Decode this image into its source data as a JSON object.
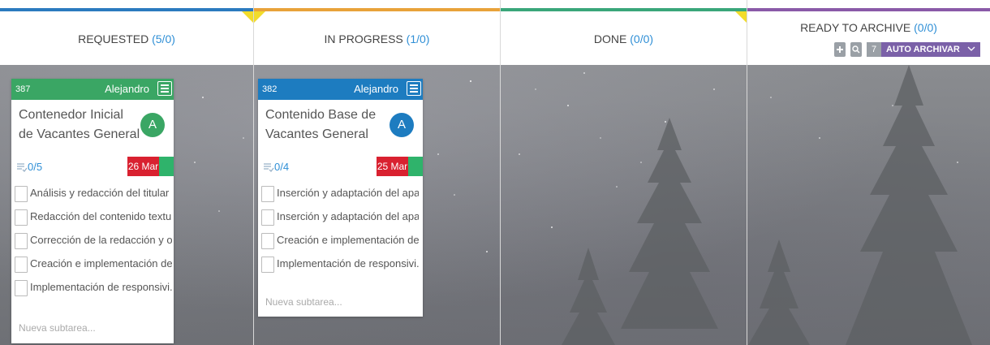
{
  "columns": [
    {
      "id": "requested",
      "title": "REQUESTED",
      "count": "(5/0)",
      "color": "#2b7bbf"
    },
    {
      "id": "in_progress",
      "title": "IN PROGRESS",
      "count": "(1/0)",
      "color": "#e8a23a"
    },
    {
      "id": "done",
      "title": "DONE",
      "count": "(0/0)",
      "color": "#3aa67a"
    },
    {
      "id": "ready_to_archive",
      "title": "READY TO ARCHIVE",
      "count": "(0/0)",
      "color": "#8a5aa8"
    }
  ],
  "archive_tools": {
    "plus_icon": "plus-icon",
    "search_icon": "search-icon",
    "count": "7",
    "auto_label": "AUTO ARCHIVAR",
    "chevron_icon": "chevron-down-icon"
  },
  "cards": [
    {
      "id": "387",
      "owner": "Alejandro",
      "title": "Contenedor Inicial de Vacantes General",
      "avatar": "A",
      "header_color": "#3aa664",
      "avatar_color": "#3aa664",
      "progress": "0/5",
      "date": "26 Mar",
      "subtasks": [
        "Análisis y redacción del titular ...",
        "Redacción del contenido textu...",
        "Corrección de la redacción y or...",
        "Creación e implementación de ...",
        "Implementación de responsivi..."
      ],
      "new_subtask_placeholder": "Nueva subtarea..."
    },
    {
      "id": "382",
      "owner": "Alejandro",
      "title": "Contenido Base de Vacantes General",
      "avatar": "A",
      "header_color": "#1d7cc0",
      "avatar_color": "#1d7cc0",
      "progress": "0/4",
      "date": "25 Mar",
      "subtasks": [
        "Inserción y adaptación del apa...",
        "Inserción y adaptación del apa...",
        "Creación e implementación de ...",
        "Implementación de responsivi..."
      ],
      "new_subtask_placeholder": "Nueva subtarea..."
    }
  ]
}
